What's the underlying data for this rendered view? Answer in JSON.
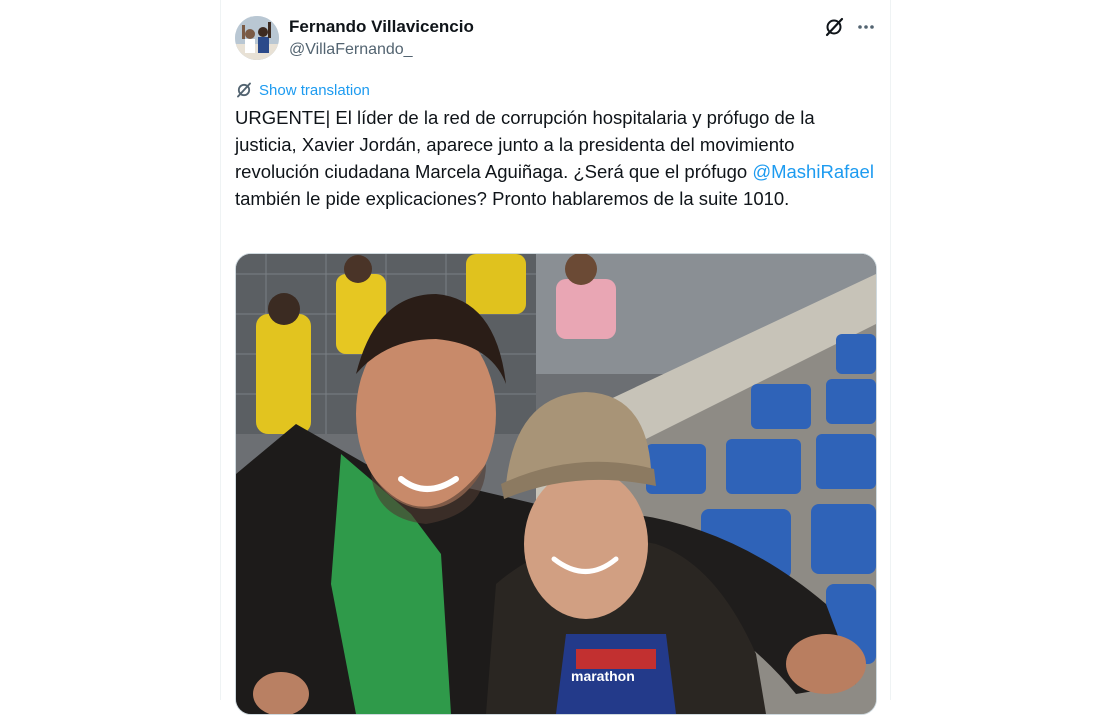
{
  "author": {
    "name": "Fernando Villavicencio",
    "handle": "@VillaFernando_"
  },
  "icons": {
    "grok": "grok-icon",
    "more": "more-icon",
    "translate": "translate-icon"
  },
  "translate_label": "Show translation",
  "tweet": {
    "text_before": "URGENTE| El líder de la red de corrupción hospitalaria y prófugo de la justicia, Xavier Jordán, aparece junto a la presidenta del movimiento revolución ciudadana Marcela Aguiñaga. ¿Será que el prófugo ",
    "mention": "@MashiRafael",
    "text_after": " también le pide explicaciones? Pronto hablaremos de la suite 1010."
  },
  "photo": {
    "shirt_print": "marathon"
  },
  "colors": {
    "accent": "#1d9bf0",
    "text": "#0f1419",
    "secondary": "#536471",
    "border": "#cfd9de"
  }
}
